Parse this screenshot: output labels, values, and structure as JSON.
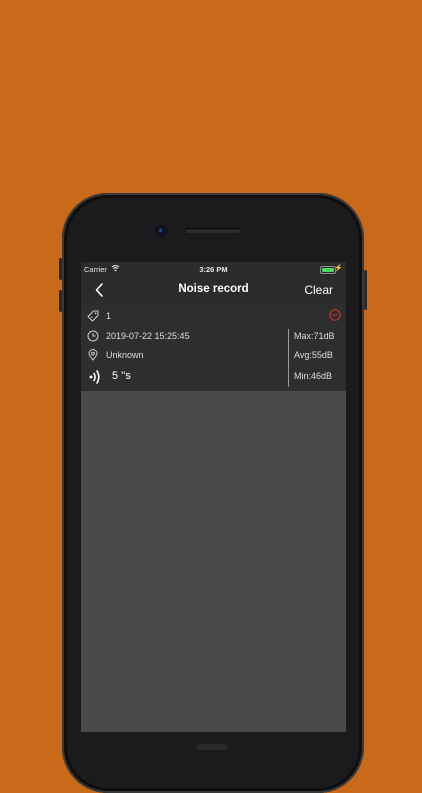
{
  "status_bar": {
    "carrier": "Carrier",
    "time": "3:26 PM",
    "battery_color": "#4cd964"
  },
  "nav": {
    "back_icon": "chevron-left-icon",
    "title": "Noise record",
    "clear_label": "Clear"
  },
  "record": {
    "tag": "1",
    "datetime": "2019-07-22 15:25:45",
    "location": "Unknown",
    "duration": "5 ''s",
    "max": "Max:71dB",
    "avg": "Avg:55dB",
    "min": "Min:46dB",
    "delete_icon": "minus-circle-icon",
    "delete_color": "#e0362e"
  },
  "colors": {
    "background": "#c86a1a",
    "bar": "#2b2b2b",
    "content": "#4a4a4a"
  }
}
